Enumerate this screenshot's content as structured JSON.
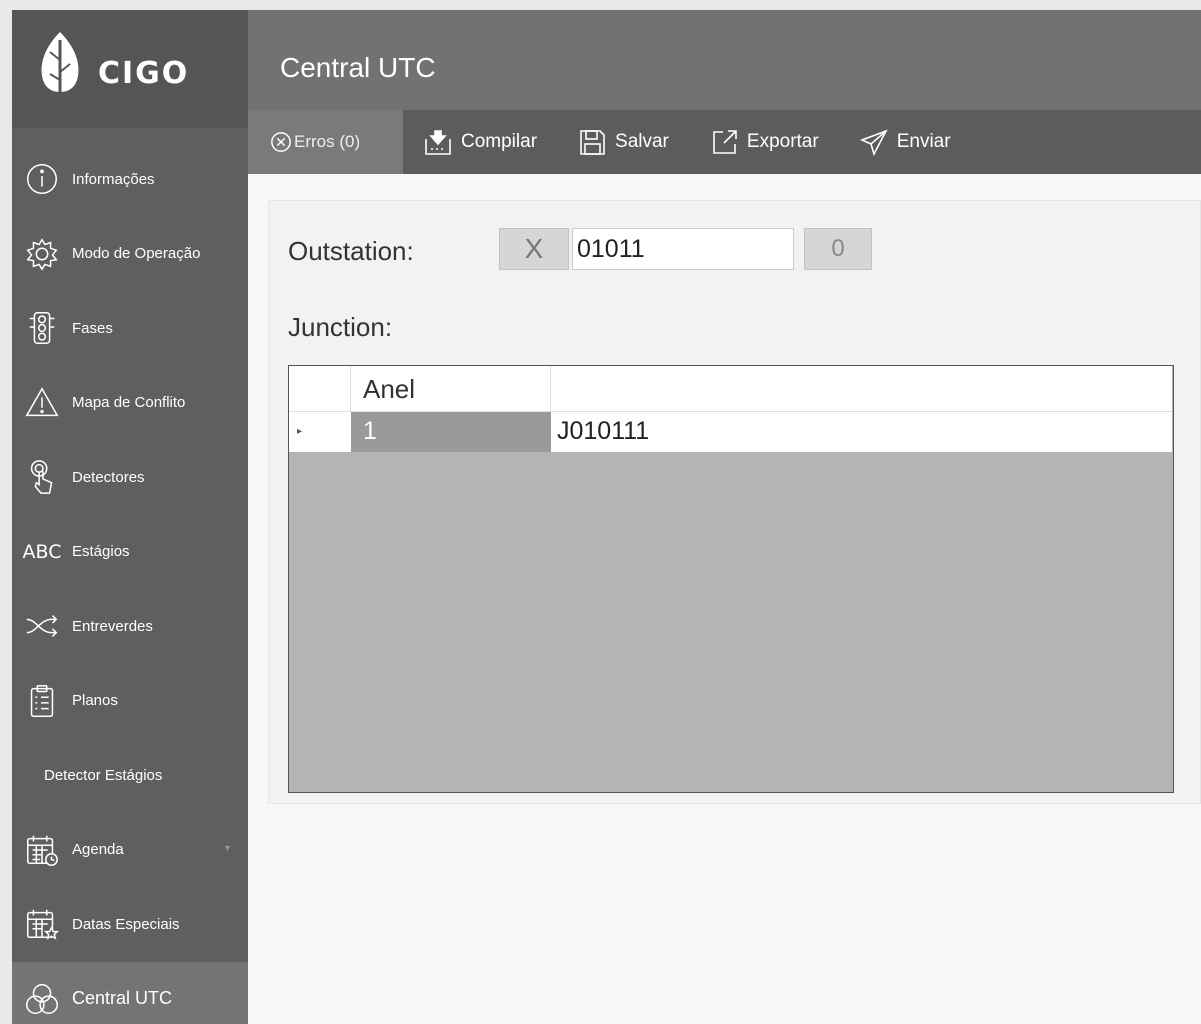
{
  "app": {
    "logo_text": "CIGO",
    "page_title": "Central UTC"
  },
  "sidebar": {
    "items": [
      {
        "label": "Informações",
        "icon": "info-icon"
      },
      {
        "label": "Modo de Operação",
        "icon": "gear-icon"
      },
      {
        "label": "Fases",
        "icon": "traffic-light-icon"
      },
      {
        "label": "Mapa de Conflito",
        "icon": "warning-icon"
      },
      {
        "label": "Detectores",
        "icon": "touch-icon"
      },
      {
        "label": "Estágios",
        "icon": "abc-icon",
        "icon_text": "ABC"
      },
      {
        "label": "Entreverdes",
        "icon": "shuffle-icon"
      },
      {
        "label": "Planos",
        "icon": "clipboard-icon"
      },
      {
        "label": "Detector Estágios"
      },
      {
        "label": "Agenda",
        "icon": "calendar-clock-icon"
      },
      {
        "label": "Datas Especiais",
        "icon": "calendar-star-icon"
      },
      {
        "label": "Central UTC",
        "icon": "circles-icon"
      }
    ]
  },
  "toolbar": {
    "errors_label": "Erros (0)",
    "compile_label": "Compilar",
    "save_label": "Salvar",
    "export_label": "Exportar",
    "send_label": "Enviar"
  },
  "form": {
    "outstation_label": "Outstation:",
    "clear_label": "X",
    "outstation_value": "01011",
    "counter_label": "0",
    "junction_label": "Junction:"
  },
  "grid": {
    "columns": [
      "Anel",
      ""
    ],
    "rows": [
      {
        "marker": "▸",
        "anel": "1",
        "junction": "J010111"
      }
    ]
  },
  "colors": {
    "sidebar": "#5f5f5f",
    "header": "#727272",
    "toolbar": "#5c5c5c"
  }
}
